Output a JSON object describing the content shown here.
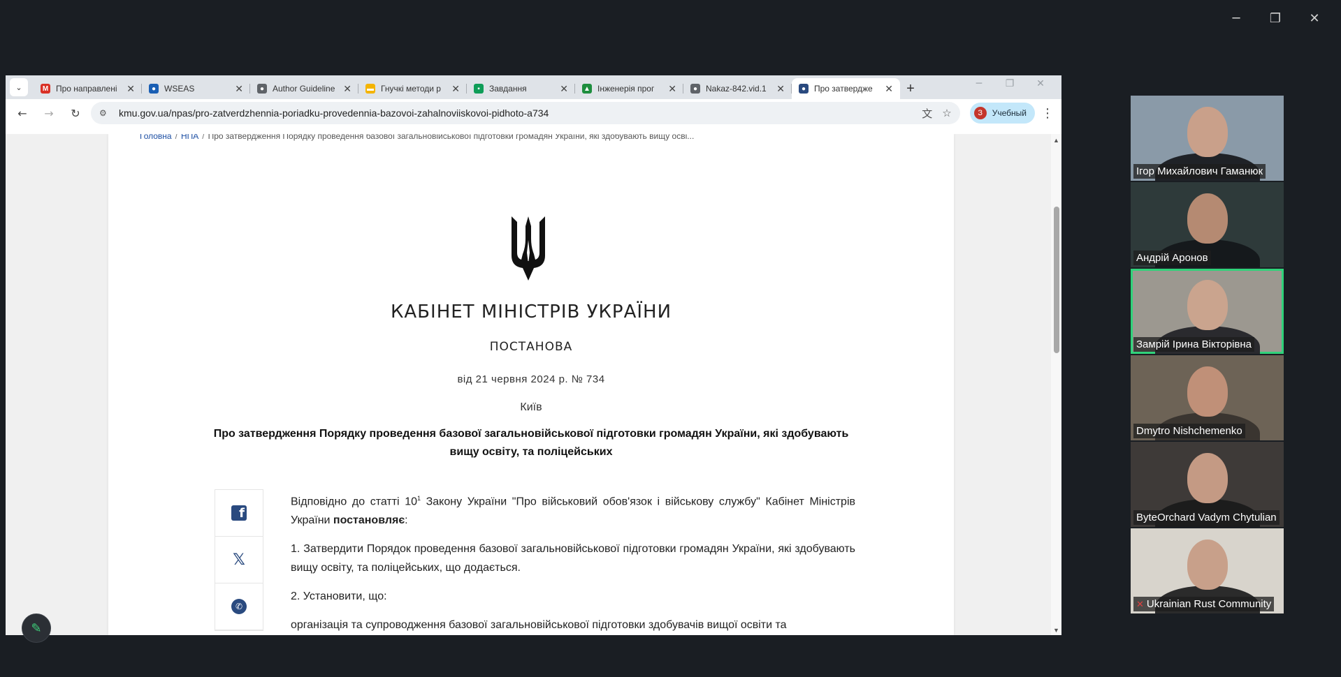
{
  "window_controls": {
    "minimize": "─",
    "restore": "❐",
    "close": "✕"
  },
  "browser": {
    "tab_menu_icon": "⌄",
    "tabs": [
      {
        "title": "Про направлені",
        "favicon": "M",
        "color": "#d93025"
      },
      {
        "title": "WSEAS",
        "favicon": "●",
        "color": "#1a5fb4"
      },
      {
        "title": "Author Guideline",
        "favicon": "●",
        "color": "#5f6368"
      },
      {
        "title": "Гнучкі методи р",
        "favicon": "▬",
        "color": "#f4b400"
      },
      {
        "title": "Завдання",
        "favicon": "▪",
        "color": "#0f9d58"
      },
      {
        "title": "Інженерія прог",
        "favicon": "▲",
        "color": "#1e8e3e"
      },
      {
        "title": "Nakaz-842.vid.1",
        "favicon": "●",
        "color": "#5f6368"
      },
      {
        "title": "Про затвердже",
        "favicon": "●",
        "color": "#2a4a7f"
      }
    ],
    "tab_close": "✕",
    "new_tab": "+",
    "url": "kmu.gov.ua/npas/pro-zatverdzhennia-poriadku-provedennia-bazovoi-zahalnoviiskovoi-pidhoto-a734",
    "profile": {
      "initial": "З",
      "label": "Учебный"
    }
  },
  "page": {
    "breadcrumb": {
      "home": "Головна",
      "npa": "НПА",
      "current": "Про затвердження Порядку проведення базової загальновійськової підготовки громадян України, які здобувають вищу осві..."
    },
    "heading": "КАБІНЕТ МІНІСТРІВ УКРАЇНИ",
    "subheading": "ПОСТАНОВА",
    "date": "від 21 червня 2024 р. № 734",
    "city": "Київ",
    "doc_title": "Про затвердження Порядку проведення базової загальновійськової підготовки громадян України, які здобувають вищу освіту, та поліцейських",
    "para1_a": "Відповідно до статті 10",
    "para1_sup": "1",
    "para1_b": " Закону України \"Про військовий обов'язок і військову службу\" Кабінет Міністрів України ",
    "para1_bold": "постановляє",
    "para1_end": ":",
    "para2": "1. Затвердити Порядок проведення базової загальновійськової підготовки громадян України, які здобувають вищу освіту, та поліцейських, що додається.",
    "para3": "2. Установити, що:",
    "para4": "організація та супроводження базової загальновійськової підготовки здобувачів вищої освіти та"
  },
  "participants": [
    {
      "name": "Ігор Михайлович Гаманюк",
      "bg": "#8a9aa8",
      "face": "#c9a08a",
      "shirt": "#1f2227",
      "muted": false,
      "speaking": false
    },
    {
      "name": "Андрій Аронов",
      "bg": "#2e3a3a",
      "face": "#b58a72",
      "shirt": "#15191c",
      "muted": false,
      "speaking": false
    },
    {
      "name": "Замрій Ірина Вікторівна",
      "bg": "#9c9890",
      "face": "#caa48e",
      "shirt": "#2a2a2e",
      "muted": false,
      "speaking": true
    },
    {
      "name": "Dmytro Nishchemenko",
      "bg": "#6d6356",
      "face": "#c09078",
      "shirt": "#3a3530",
      "muted": false,
      "speaking": false
    },
    {
      "name": "ByteOrchard Vadym Chytulian",
      "bg": "#3e3a38",
      "face": "#c49a84",
      "shirt": "#1c1c1c",
      "muted": false,
      "speaking": false
    },
    {
      "name": "Ukrainian Rust Community",
      "bg": "#d8d4cc",
      "face": "#c8a08a",
      "shirt": "#2b2b2b",
      "muted": true,
      "speaking": false
    }
  ]
}
